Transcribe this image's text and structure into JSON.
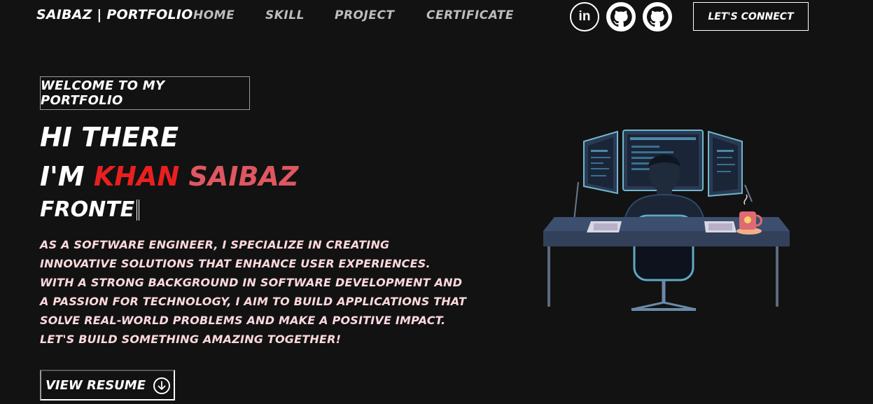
{
  "header": {
    "brand": "SAIBAZ | PORTFOLIO",
    "nav": [
      "HOME",
      "SKILL",
      "PROJECT",
      "CERTIFICATE"
    ],
    "social_icons": [
      "linkedin-icon",
      "github-icon",
      "github-icon"
    ],
    "social_linkedin_text": "in",
    "connect_label": "LET'S CONNECT"
  },
  "hero": {
    "welcome": "WELCOME TO MY PORTFOLIO",
    "line1": "HI THERE",
    "line2_prefix": "I'M ",
    "name_first": "KHAN",
    "name_last": "SAIBAZ",
    "typed_text": "FRONTE",
    "description": "AS A SOFTWARE ENGINEER, I SPECIALIZE IN CREATING INNOVATIVE SOLUTIONS THAT ENHANCE USER EXPERIENCES. WITH A STRONG BACKGROUND IN SOFTWARE DEVELOPMENT AND A PASSION FOR TECHNOLOGY, I AIM TO BUILD APPLICATIONS THAT SOLVE REAL-WORLD PROBLEMS AND MAKE A POSITIVE IMPACT. LET'S BUILD SOMETHING AMAZING TOGETHER!",
    "resume_label": "VIEW RESUME",
    "resume_icon": "arrow-down-circle-icon"
  },
  "colors": {
    "background": "#121212",
    "name_first": "#e8201f",
    "name_last": "#df5760",
    "description": "#ffd9de",
    "nav": "#bdbdbd"
  },
  "illustration": "developer-at-desk-illustration"
}
